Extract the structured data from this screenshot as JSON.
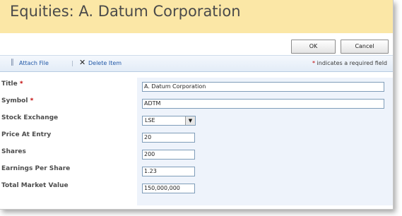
{
  "page": {
    "title": "Equities: A. Datum Corporation"
  },
  "buttons": {
    "ok": "OK",
    "cancel": "Cancel"
  },
  "toolbar": {
    "attach_label": "Attach File",
    "separator": "|",
    "delete_label": "Delete Item",
    "required_note_star": "*",
    "required_note": " indicates a required field"
  },
  "fields": [
    {
      "label": "Title",
      "required_star": "*",
      "value": "A. Datum Corporation",
      "type": "text"
    },
    {
      "label": "Symbol",
      "required_star": "*",
      "value": "ADTM",
      "type": "text"
    },
    {
      "label": "Stock Exchange",
      "required_star": "",
      "value": "LSE",
      "type": "select"
    },
    {
      "label": "Price At Entry",
      "required_star": "",
      "value": "20",
      "type": "text"
    },
    {
      "label": "Shares",
      "required_star": "",
      "value": "200",
      "type": "text"
    },
    {
      "label": "Earnings Per Share",
      "required_star": "",
      "value": "1.23",
      "type": "text"
    },
    {
      "label": "Total Market Value",
      "required_star": "",
      "value": "150,000,000",
      "type": "text"
    }
  ],
  "icons": {
    "attach": "paperclip-icon",
    "delete": "x-delete-icon",
    "dropdown": "dropdown-arrow-icon"
  },
  "colors": {
    "title_bar": "#fbe7a6",
    "link": "#2157a6",
    "required": "#c00000",
    "field_bg": "#eef3fb"
  }
}
